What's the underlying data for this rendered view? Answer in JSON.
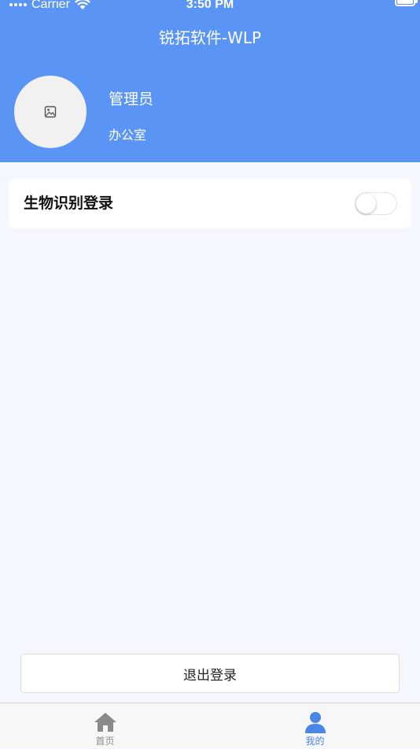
{
  "status_bar": {
    "carrier": "Carrier",
    "time": "3:50 PM"
  },
  "header": {
    "title": "锐拓软件-WLP",
    "background_color": "#5a95f5"
  },
  "user": {
    "avatar_icon": "image-placeholder-icon",
    "name": "管理员",
    "department": "办公室"
  },
  "settings": {
    "biometric_login_label": "生物识别登录",
    "biometric_login_enabled": false
  },
  "logout_label": "退出登录",
  "tab_bar": {
    "items": [
      {
        "label": "首页",
        "icon": "home-icon",
        "active": false,
        "color": "#8a8a8a"
      },
      {
        "label": "我的",
        "icon": "user-icon",
        "active": true,
        "color": "#4a86e8"
      }
    ]
  }
}
